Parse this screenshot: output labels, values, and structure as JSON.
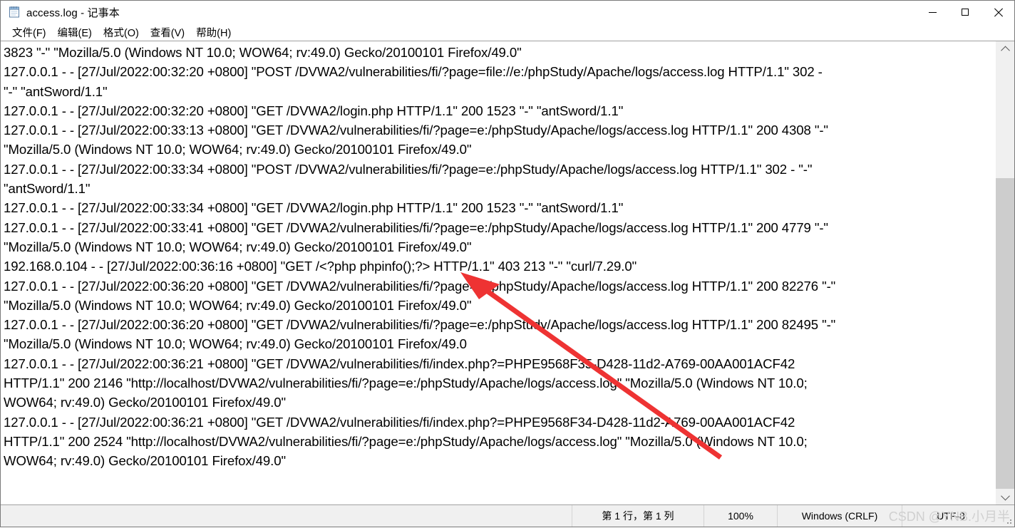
{
  "window": {
    "title": "access.log - 记事本",
    "icon": "notepad-icon",
    "controls": {
      "minimize": "—",
      "maximize": "□",
      "close": "✕"
    }
  },
  "menubar": {
    "items": [
      {
        "label": "文件(F)",
        "name": "menu-file"
      },
      {
        "label": "编辑(E)",
        "name": "menu-edit"
      },
      {
        "label": "格式(O)",
        "name": "menu-format"
      },
      {
        "label": "查看(V)",
        "name": "menu-view"
      },
      {
        "label": "帮助(H)",
        "name": "menu-help"
      }
    ]
  },
  "editor": {
    "lines": [
      "3823 \"-\" \"Mozilla/5.0 (Windows NT 10.0; WOW64; rv:49.0) Gecko/20100101 Firefox/49.0\"",
      "127.0.0.1 - - [27/Jul/2022:00:32:20 +0800] \"POST /DVWA2/vulnerabilities/fi/?page=file://e:/phpStudy/Apache/logs/access.log HTTP/1.1\" 302 -",
      "\"-\" \"antSword/1.1\"",
      "127.0.0.1 - - [27/Jul/2022:00:32:20 +0800] \"GET /DVWA2/login.php HTTP/1.1\" 200 1523 \"-\" \"antSword/1.1\"",
      "127.0.0.1 - - [27/Jul/2022:00:33:13 +0800] \"GET /DVWA2/vulnerabilities/fi/?page=e:/phpStudy/Apache/logs/access.log HTTP/1.1\" 200 4308 \"-\"",
      "\"Mozilla/5.0 (Windows NT 10.0; WOW64; rv:49.0) Gecko/20100101 Firefox/49.0\"",
      "127.0.0.1 - - [27/Jul/2022:00:33:34 +0800] \"POST /DVWA2/vulnerabilities/fi/?page=e:/phpStudy/Apache/logs/access.log HTTP/1.1\" 302 - \"-\"",
      "\"antSword/1.1\"",
      "127.0.0.1 - - [27/Jul/2022:00:33:34 +0800] \"GET /DVWA2/login.php HTTP/1.1\" 200 1523 \"-\" \"antSword/1.1\"",
      "127.0.0.1 - - [27/Jul/2022:00:33:41 +0800] \"GET /DVWA2/vulnerabilities/fi/?page=e:/phpStudy/Apache/logs/access.log HTTP/1.1\" 200 4779 \"-\"",
      "\"Mozilla/5.0 (Windows NT 10.0; WOW64; rv:49.0) Gecko/20100101 Firefox/49.0\"",
      "192.168.0.104 - - [27/Jul/2022:00:36:16 +0800] \"GET /<?php phpinfo();?> HTTP/1.1\" 403 213 \"-\" \"curl/7.29.0\"",
      "127.0.0.1 - - [27/Jul/2022:00:36:20 +0800] \"GET /DVWA2/vulnerabilities/fi/?page=e:/phpStudy/Apache/logs/access.log HTTP/1.1\" 200 82276 \"-\"",
      "\"Mozilla/5.0 (Windows NT 10.0; WOW64; rv:49.0) Gecko/20100101 Firefox/49.0\"",
      "127.0.0.1 - - [27/Jul/2022:00:36:20 +0800] \"GET /DVWA2/vulnerabilities/fi/?page=e:/phpStudy/Apache/logs/access.log HTTP/1.1\" 200 82495 \"-\"",
      "\"Mozilla/5.0 (Windows NT 10.0; WOW64; rv:49.0) Gecko/20100101 Firefox/49.0",
      "127.0.0.1 - - [27/Jul/2022:00:36:21 +0800] \"GET /DVWA2/vulnerabilities/fi/index.php?=PHPE9568F35-D428-11d2-A769-00AA001ACF42",
      "HTTP/1.1\" 200 2146 \"http://localhost/DVWA2/vulnerabilities/fi/?page=e:/phpStudy/Apache/logs/access.log\" \"Mozilla/5.0 (Windows NT 10.0;",
      "WOW64; rv:49.0) Gecko/20100101 Firefox/49.0\"",
      "127.0.0.1 - - [27/Jul/2022:00:36:21 +0800] \"GET /DVWA2/vulnerabilities/fi/index.php?=PHPE9568F34-D428-11d2-A769-00AA001ACF42",
      "HTTP/1.1\" 200 2524 \"http://localhost/DVWA2/vulnerabilities/fi/?page=e:/phpStudy/Apache/logs/access.log\" \"Mozilla/5.0 (Windows NT 10.0;",
      "WOW64; rv:49.0) Gecko/20100101 Firefox/49.0\""
    ]
  },
  "scrollbar": {
    "up_arrow": "scroll-up",
    "down_arrow": "scroll-down"
  },
  "statusbar": {
    "position": "第 1 行，第 1 列",
    "zoom": "100%",
    "line_ending": "Windows (CRLF)",
    "encoding": "UTF-8"
  },
  "annotation": {
    "watermark": "CSDN @YNB.小月半",
    "arrow_color": "#ee3333"
  }
}
